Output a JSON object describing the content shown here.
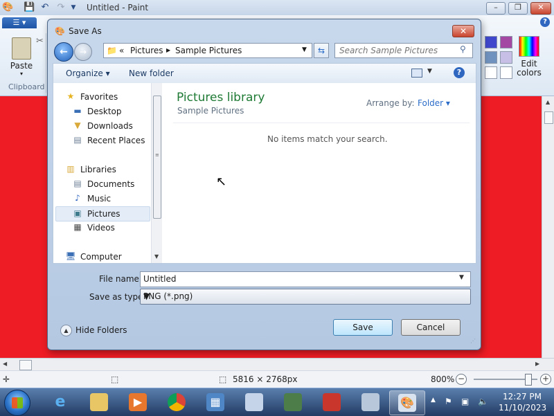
{
  "paint": {
    "window_title": "Untitled - Paint",
    "ribbon": {
      "paste_label": "Paste",
      "clipboard_group_label": "Clipboard",
      "edit_colors_label": "Edit colors"
    },
    "swatch_colors": [
      "#3f48cc",
      "#a349a4",
      "#7092be",
      "#c8bfe7",
      "#ffffff",
      "#ffffff"
    ]
  },
  "dialog": {
    "title": "Save As",
    "breadcrumb": {
      "prefix": "«",
      "folder": "Pictures",
      "separator": "▶",
      "subfolder": "Sample Pictures"
    },
    "search_placeholder": "Search Sample Pictures",
    "toolbar": {
      "organize": "Organize ▾",
      "new_folder": "New folder"
    },
    "nav": {
      "favorites_header": "Favorites",
      "favorites": [
        "Desktop",
        "Downloads",
        "Recent Places"
      ],
      "libraries_header": "Libraries",
      "libraries": [
        "Documents",
        "Music",
        "Pictures",
        "Videos"
      ],
      "computer": "Computer",
      "selected": "Pictures"
    },
    "library": {
      "title": "Pictures library",
      "subtitle": "Sample Pictures",
      "arrange_label": "Arrange by:",
      "arrange_value": "Folder ▾",
      "empty_message": "No items match your search."
    },
    "file_name_label": "File name:",
    "file_name_value": "Untitled",
    "save_type_label": "Save as type:",
    "save_type_value": "PNG (*.png)",
    "hide_folders": "Hide Folders",
    "save_button": "Save",
    "cancel_button": "Cancel"
  },
  "statusbar": {
    "dimensions": "5816 × 2768px",
    "zoom": "800%"
  },
  "taskbar": {
    "clock_time": "12:27 PM",
    "clock_date": "11/10/2023"
  }
}
